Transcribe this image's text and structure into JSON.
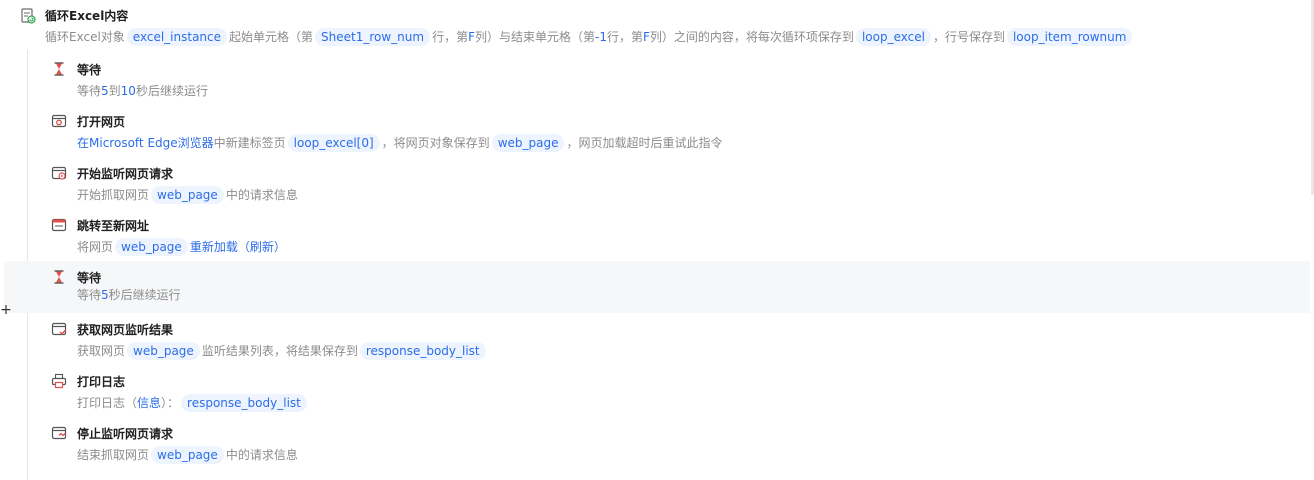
{
  "loop": {
    "icon": "excel-loop-icon",
    "title": "循环Excel内容",
    "desc": {
      "p1": "循环Excel对象",
      "t1": "excel_instance",
      "p2": "起始单元格（第",
      "t2": "Sheet1_row_num",
      "p3": "行，第",
      "p4": "F",
      "p5": "列）与结束单元格（第",
      "p6": "-1",
      "p7": "行，第",
      "p8": "F",
      "p9": "列）之间的内容，将每次循环项保存到",
      "t3": "loop_excel",
      "p10": "，行号保存到",
      "t4": "loop_item_rownum"
    }
  },
  "steps": [
    {
      "icon": "hourglass-icon",
      "title": "等待",
      "d": {
        "p1": "等待",
        "n1": "5",
        "p2": "到",
        "n2": "10",
        "p3": "秒后继续运行"
      }
    },
    {
      "icon": "browser-open-icon",
      "title": "打开网页",
      "d": {
        "p1": "在",
        "b1": "Microsoft Edge浏览器",
        "p2": "中新建标签页",
        "t1": "loop_excel[0]",
        "p3": "，将网页对象保存到",
        "t2": "web_page",
        "p4": "，网页加载超时后重试此指令"
      }
    },
    {
      "icon": "listen-start-icon",
      "title": "开始监听网页请求",
      "d": {
        "p1": "开始抓取网页",
        "t1": "web_page",
        "p2": "中的请求信息"
      }
    },
    {
      "icon": "browser-goto-icon",
      "title": "跳转至新网址",
      "d": {
        "p1": "将网页",
        "t1": "web_page",
        "b1": "重新加载（刷新）"
      }
    },
    {
      "icon": "hourglass-icon",
      "title": "等待",
      "d": {
        "p1": "等待",
        "n1": "5",
        "p2": "秒后继续运行"
      }
    },
    {
      "icon": "listen-result-icon",
      "title": "获取网页监听结果",
      "d": {
        "p1": "获取网页",
        "t1": "web_page",
        "p2": "监听结果列表，将结果保存到",
        "t2": "response_body_list"
      }
    },
    {
      "icon": "printer-icon",
      "title": "打印日志",
      "d": {
        "p1": "打印日志（",
        "b1": "信息",
        "p2": "）：",
        "t1": "response_body_list"
      }
    },
    {
      "icon": "listen-stop-icon",
      "title": "停止监听网页请求",
      "d": {
        "p1": "结束抓取网页",
        "t1": "web_page",
        "p2": "中的请求信息"
      }
    }
  ],
  "controls": {
    "add": "+"
  },
  "colors": {
    "accent": "#2b6de8",
    "token_bg": "#eef4fe",
    "muted": "#8c8c8c",
    "icon_red": "#e0524b",
    "highlight": "#f6f7f9"
  }
}
